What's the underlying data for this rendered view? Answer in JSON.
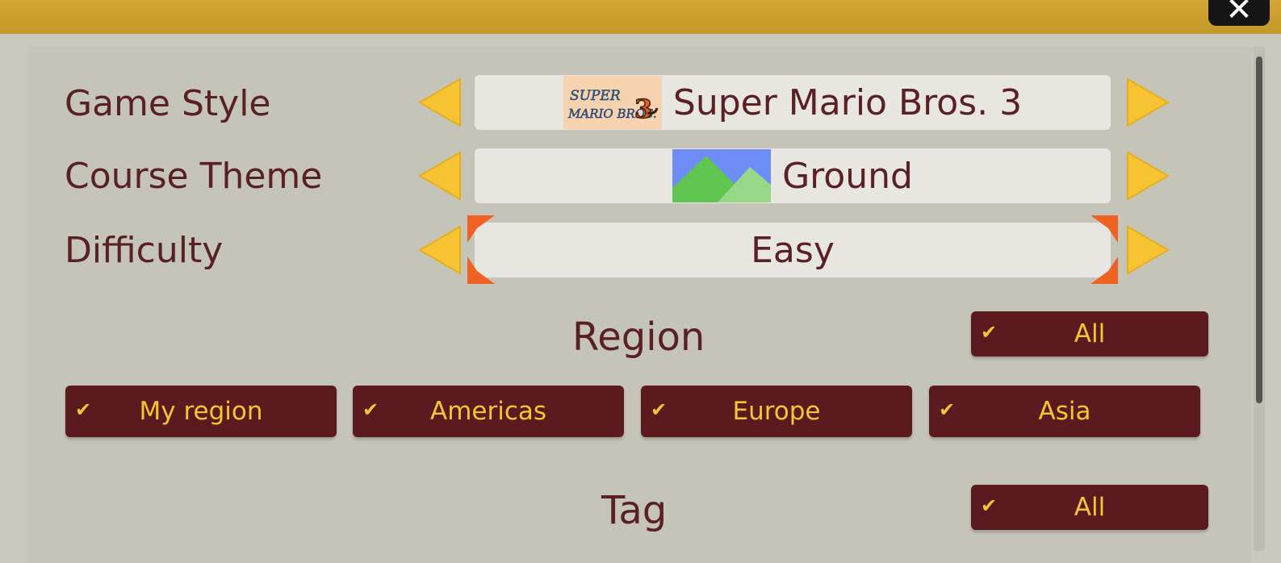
{
  "window": {
    "close_icon": "close-icon",
    "close_glyph": "✕"
  },
  "rows": [
    {
      "label": "Game Style",
      "value": "Super Mario Bros. 3",
      "thumbnail": "smb3-logo-thumbnail"
    },
    {
      "label": "Course Theme",
      "value": "Ground",
      "thumbnail": "ground-theme-thumbnail"
    },
    {
      "label": "Difficulty",
      "value": "Easy",
      "selected": true
    }
  ],
  "region": {
    "title": "Region",
    "all_label": "All",
    "options": [
      "My region",
      "Americas",
      "Europe",
      "Asia"
    ],
    "checked": [
      true,
      true,
      true,
      true
    ]
  },
  "tag": {
    "title": "Tag",
    "all_label": "All"
  },
  "icons": {
    "check": "✔",
    "arrow_left": "triangle-left-icon",
    "arrow_right": "triangle-right-icon"
  },
  "colors": {
    "arrow_yellow": "#f6c432",
    "button_bg": "#5b1a1e",
    "button_text": "#f4c534",
    "label_text": "#5a2024",
    "selection_orange": "#f06124"
  }
}
